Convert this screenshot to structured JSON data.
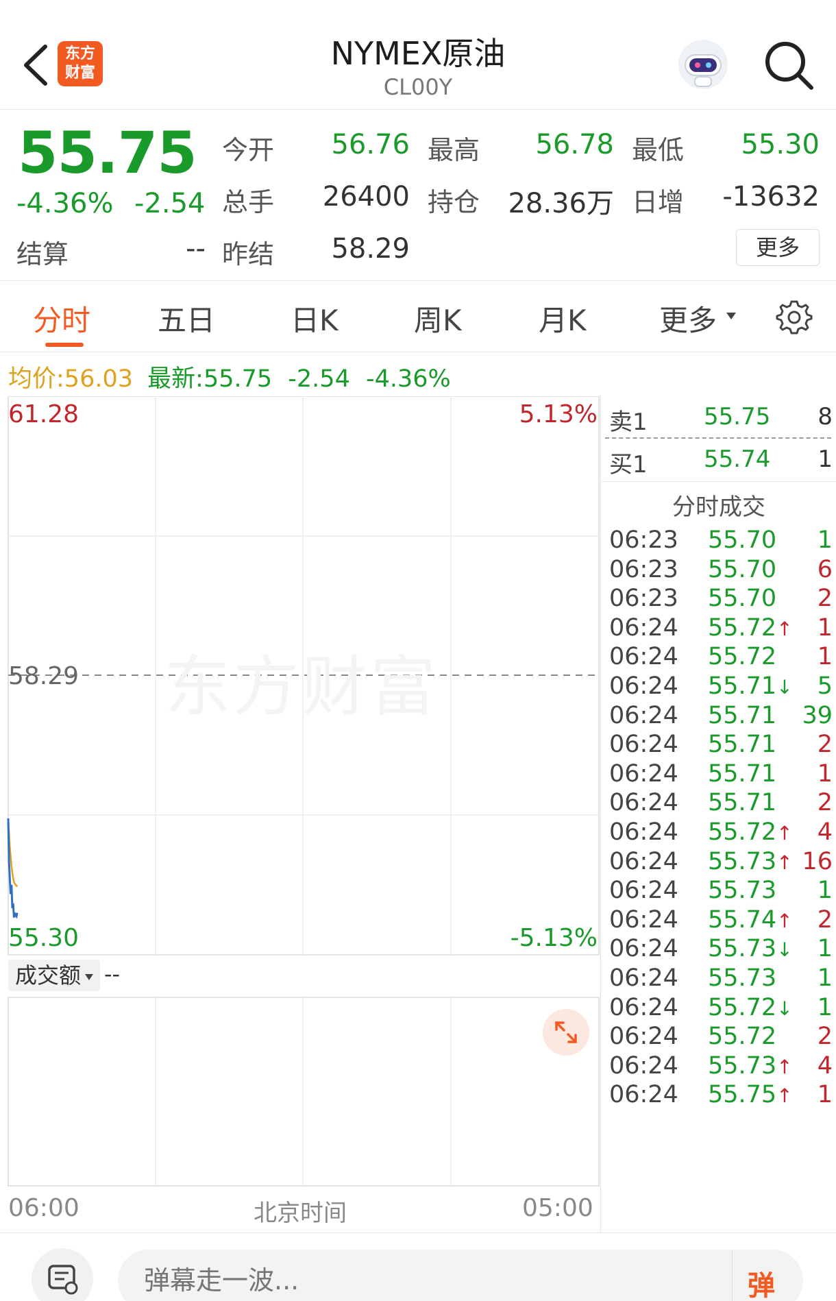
{
  "header": {
    "title": "NYMEX原油",
    "subtitle": "CL00Y",
    "logo_line1": "东方",
    "logo_line2": "财富"
  },
  "quote": {
    "price": "55.75",
    "pct_change": "-4.36%",
    "abs_change": "-2.54",
    "settle_label": "结算",
    "settle_value": "--",
    "open_label": "今开",
    "open_value": "56.76",
    "high_label": "最高",
    "high_value": "56.78",
    "low_label": "最低",
    "low_value": "55.30",
    "volume_label": "总手",
    "volume_value": "26400",
    "oi_label": "持仓",
    "oi_value": "28.36万",
    "daily_inc_label": "日增",
    "daily_inc_value": "-13632",
    "prev_settle_label": "昨结",
    "prev_settle_value": "58.29",
    "more_label": "更多"
  },
  "tabs": [
    {
      "label": "分时",
      "active": true
    },
    {
      "label": "五日",
      "active": false
    },
    {
      "label": "日K",
      "active": false
    },
    {
      "label": "周K",
      "active": false
    },
    {
      "label": "月K",
      "active": false
    },
    {
      "label": "更多",
      "active": false
    }
  ],
  "info_line": {
    "avg_label": "均价:",
    "avg_value": "56.03",
    "latest_label": "最新:",
    "latest_value": "55.75",
    "latest_abs": "-2.54",
    "latest_pct": "-4.36%"
  },
  "chart": {
    "price_top": "61.28",
    "pct_top": "5.13%",
    "prev_ref": "58.29",
    "price_bottom": "55.30",
    "pct_bottom": "-5.13%",
    "watermark": "东方财富",
    "volume_selector": "成交额",
    "volume_value": "--",
    "time_start": "06:00",
    "time_mid": "北京时间",
    "time_end": "05:00"
  },
  "chart_data": {
    "type": "line",
    "ylim": [
      55.3,
      61.28
    ],
    "reference": 58.29,
    "series": [
      {
        "values": [
          56.76,
          56.3,
          56.1,
          55.95,
          56.05,
          55.8,
          55.85,
          55.7,
          55.75,
          55.72,
          55.71,
          55.75
        ]
      },
      {
        "values": [
          56.76,
          56.6,
          56.45,
          56.35,
          56.25,
          56.18,
          56.12,
          56.08,
          56.06,
          56.05,
          56.04,
          56.03
        ]
      }
    ],
    "colors": {
      "price": "#2f6fc4",
      "avg": "#e0a020"
    }
  },
  "orderbook": {
    "sell_label": "卖1",
    "sell_price": "55.75",
    "sell_qty": "8",
    "buy_label": "买1",
    "buy_price": "55.74",
    "buy_qty": "1"
  },
  "ticks_title": "分时成交",
  "ticks": [
    {
      "time": "06:23",
      "price": "55.70",
      "arrow": "",
      "vol": "1",
      "vol_color": "green"
    },
    {
      "time": "06:23",
      "price": "55.70",
      "arrow": "",
      "vol": "6",
      "vol_color": "red"
    },
    {
      "time": "06:23",
      "price": "55.70",
      "arrow": "",
      "vol": "2",
      "vol_color": "red"
    },
    {
      "time": "06:24",
      "price": "55.72",
      "arrow": "↑",
      "vol": "1",
      "vol_color": "red"
    },
    {
      "time": "06:24",
      "price": "55.72",
      "arrow": "",
      "vol": "1",
      "vol_color": "red"
    },
    {
      "time": "06:24",
      "price": "55.71",
      "arrow": "↓",
      "vol": "5",
      "vol_color": "green"
    },
    {
      "time": "06:24",
      "price": "55.71",
      "arrow": "",
      "vol": "39",
      "vol_color": "green"
    },
    {
      "time": "06:24",
      "price": "55.71",
      "arrow": "",
      "vol": "2",
      "vol_color": "red"
    },
    {
      "time": "06:24",
      "price": "55.71",
      "arrow": "",
      "vol": "1",
      "vol_color": "red"
    },
    {
      "time": "06:24",
      "price": "55.71",
      "arrow": "",
      "vol": "2",
      "vol_color": "red"
    },
    {
      "time": "06:24",
      "price": "55.72",
      "arrow": "↑",
      "vol": "4",
      "vol_color": "red"
    },
    {
      "time": "06:24",
      "price": "55.73",
      "arrow": "↑",
      "vol": "16",
      "vol_color": "red"
    },
    {
      "time": "06:24",
      "price": "55.73",
      "arrow": "",
      "vol": "1",
      "vol_color": "green"
    },
    {
      "time": "06:24",
      "price": "55.74",
      "arrow": "↑",
      "vol": "2",
      "vol_color": "red"
    },
    {
      "time": "06:24",
      "price": "55.73",
      "arrow": "↓",
      "vol": "1",
      "vol_color": "green"
    },
    {
      "time": "06:24",
      "price": "55.73",
      "arrow": "",
      "vol": "1",
      "vol_color": "green"
    },
    {
      "time": "06:24",
      "price": "55.72",
      "arrow": "↓",
      "vol": "1",
      "vol_color": "green"
    },
    {
      "time": "06:24",
      "price": "55.72",
      "arrow": "",
      "vol": "2",
      "vol_color": "red"
    },
    {
      "time": "06:24",
      "price": "55.73",
      "arrow": "↑",
      "vol": "4",
      "vol_color": "red"
    },
    {
      "time": "06:24",
      "price": "55.75",
      "arrow": "↑",
      "vol": "1",
      "vol_color": "red"
    }
  ],
  "bottom_bar": {
    "input_placeholder": "弹幕走一波...",
    "danmu_button": "弹"
  },
  "icons": {
    "back": "back-arrow-icon",
    "search": "search-icon",
    "settings": "gear-icon",
    "expand": "expand-icon",
    "comment": "comment-icon",
    "robot": "robot-avatar-icon"
  }
}
